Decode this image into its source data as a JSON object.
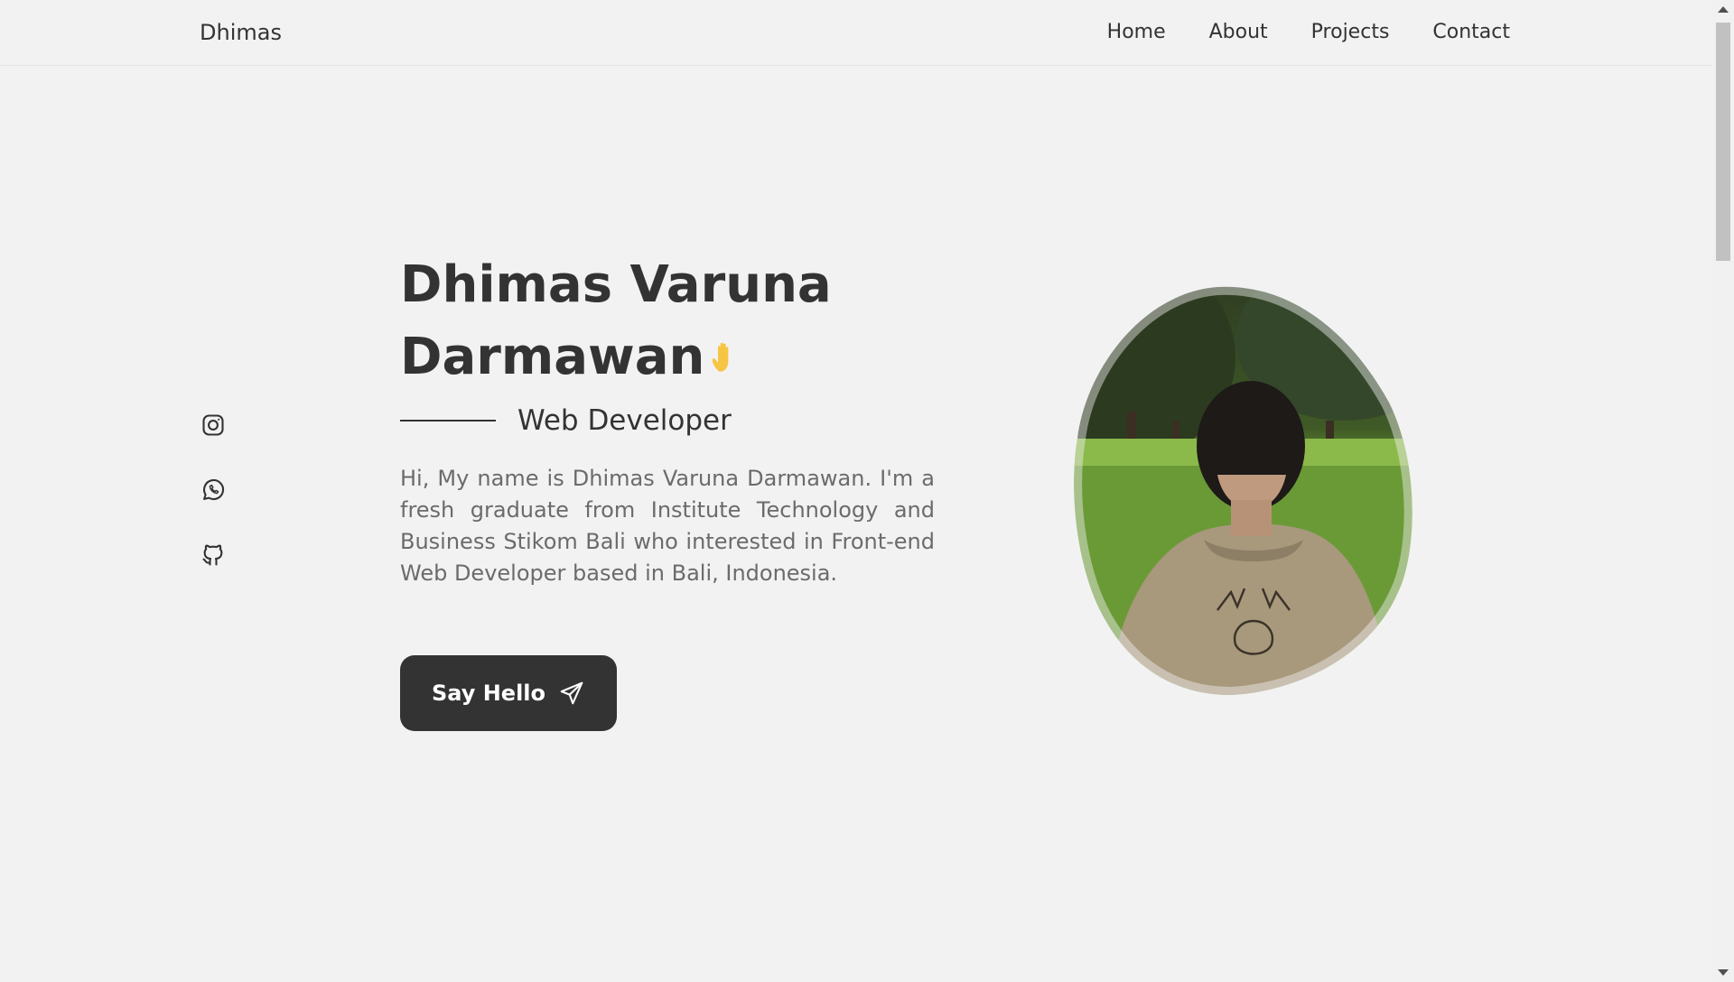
{
  "header": {
    "logo": "Dhimas",
    "nav": [
      {
        "label": "Home"
      },
      {
        "label": "About"
      },
      {
        "label": "Projects"
      },
      {
        "label": "Contact"
      }
    ]
  },
  "social": {
    "icons": [
      "instagram-icon",
      "whatsapp-icon",
      "github-icon"
    ]
  },
  "hero": {
    "title_line1": "Dhimas Varuna",
    "title_line2": "Darmawan",
    "emoji_icon": "waving-hand-icon",
    "subtitle": "Web Developer",
    "description": "Hi, My name is Dhimas Varuna Darmawan. I'm a fresh graduate from Institute Technology and Business Stikom Bali who interested in Front-end Web Developer based in Bali, Indonesia.",
    "cta_label": "Say Hello",
    "cta_icon": "send-icon"
  },
  "colors": {
    "background": "#f2f2f2",
    "text": "#333333",
    "muted_text": "#6b6b6b",
    "button_bg": "#333333",
    "button_text": "#ffffff",
    "emoji": "#f6c544"
  }
}
